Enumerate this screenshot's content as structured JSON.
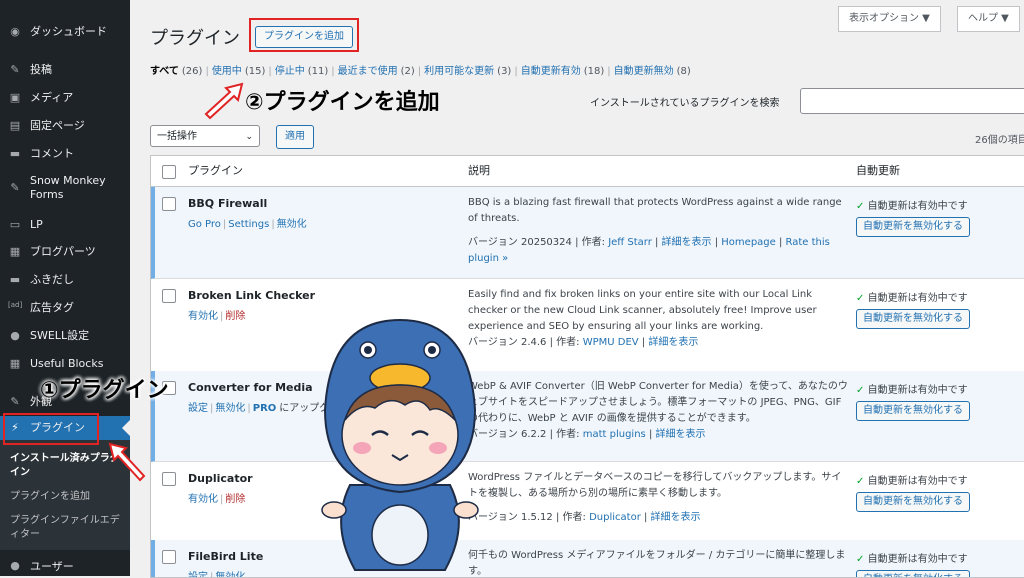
{
  "sidebar": {
    "items": [
      {
        "label": "ダッシュボード",
        "icon": "dashboard-icon",
        "glyph": "◉"
      },
      {
        "label": "投稿",
        "icon": "pin-icon",
        "glyph": "✎"
      },
      {
        "label": "メディア",
        "icon": "media-icon",
        "glyph": "▣"
      },
      {
        "label": "固定ページ",
        "icon": "page-icon",
        "glyph": "▤"
      },
      {
        "label": "コメント",
        "icon": "comment-icon",
        "glyph": "▬"
      },
      {
        "label": "Snow Monkey Forms",
        "icon": "pin-icon",
        "glyph": "✎"
      },
      {
        "label": "LP",
        "icon": "lp-icon",
        "glyph": "▭"
      },
      {
        "label": "ブログパーツ",
        "icon": "blog-parts-icon",
        "glyph": "▦"
      },
      {
        "label": "ふきだし",
        "icon": "balloon-icon",
        "glyph": "▬"
      },
      {
        "label": "広告タグ",
        "icon": "ad-icon",
        "glyph": "[ad]"
      },
      {
        "label": "SWELL設定",
        "icon": "swell-icon",
        "glyph": "●"
      },
      {
        "label": "Useful Blocks",
        "icon": "blocks-icon",
        "glyph": "▦"
      },
      {
        "label": "外観",
        "icon": "appearance-icon",
        "glyph": "✎"
      },
      {
        "label": "プラグイン",
        "icon": "plugin-icon",
        "glyph": "⚡"
      }
    ],
    "submenu": [
      "インストール済みプラグイン",
      "プラグインを追加",
      "プラグインファイルエディター"
    ],
    "user_label": "ユーザー"
  },
  "header": {
    "title": "プラグイン",
    "add_button": "プラグインを追加",
    "screen_options": "表示オプション ▼",
    "help": "ヘルプ ▼"
  },
  "filters": [
    {
      "label": "すべて",
      "count": "(26)"
    },
    {
      "label": "使用中",
      "count": "(15)"
    },
    {
      "label": "停止中",
      "count": "(11)"
    },
    {
      "label": "最近まで使用",
      "count": "(2)"
    },
    {
      "label": "利用可能な更新",
      "count": "(3)"
    },
    {
      "label": "自動更新有効",
      "count": "(18)"
    },
    {
      "label": "自動更新無効",
      "count": "(8)"
    }
  ],
  "search_label": "インストールされているプラグインを検索",
  "bulk_action": "一括操作",
  "apply_button": "適用",
  "item_count": "26個の項目",
  "table": {
    "headers": [
      "プラグイン",
      "説明",
      "自動更新"
    ],
    "rows": [
      {
        "name": "BBQ Firewall",
        "links": [
          "Go Pro",
          "Settings",
          "無効化"
        ],
        "desc": "BBQ is a blazing fast firewall that protects WordPress against a wide range of threats.",
        "version": "バージョン 20250324",
        "author_label": "作者:",
        "author": "Jeff Starr",
        "extra_links": [
          "詳細を表示",
          "Homepage",
          "Rate this plugin »"
        ],
        "au_status": "自動更新は有効中です",
        "au_button": "自動更新を無効化する"
      },
      {
        "name": "Broken Link Checker",
        "links": [
          "有効化",
          "削除"
        ],
        "desc": "Easily find and fix broken links on your entire site with our Local Link checker or the new Cloud Link scanner, absolutely free! Improve user experience and SEO by ensuring all your links are working.",
        "version": "バージョン 2.4.6",
        "author_label": "作者:",
        "author": "WPMU DEV",
        "extra_links": [
          "詳細を表示"
        ],
        "au_status": "自動更新は有効中です",
        "au_button": "自動更新を無効化する"
      },
      {
        "name": "Converter for Media",
        "links": [
          "設定",
          "無効化",
          "PRO",
          "にアップグレード"
        ],
        "desc": "WebP & AVIF Converter（旧 WebP Converter for Media）を使って、あなたのウェブサイトをスピードアップさせましょう。標準フォーマットの JPEG、PNG、GIF の代わりに、WebP と AVIF の画像を提供することができます。",
        "version": "バージョン 6.2.2",
        "author_label": "作者:",
        "author": "matt plugins",
        "extra_links": [
          "詳細を表示"
        ],
        "au_status": "自動更新は有効中です",
        "au_button": "自動更新を無効化する"
      },
      {
        "name": "Duplicator",
        "links": [
          "有効化",
          "削除"
        ],
        "desc": "WordPress ファイルとデータベースのコピーを移行してバックアップします。サイトを複製し、ある場所から別の場所に素早く移動します。",
        "version": "バージョン 1.5.12",
        "author_label": "作者:",
        "author": "Duplicator",
        "extra_links": [
          "詳細を表示"
        ],
        "au_status": "自動更新は有効中です",
        "au_button": "自動更新を無効化する"
      },
      {
        "name": "FileBird Lite",
        "links": [
          "設定",
          "無効化"
        ],
        "desc": "何千もの WordPress メディアファイルをフォルダー / カテゴリーに簡単に整理します。",
        "version": "",
        "author_label": "",
        "author": "",
        "extra_links": [],
        "au_status": "自動更新は有効中です",
        "au_button": "自動更新を無効化する"
      }
    ]
  },
  "annotations": {
    "step1": "①プラグイン",
    "step2": "②プラグインを追加"
  },
  "colors": {
    "sidebar_bg": "#1d2327",
    "accent": "#2271b1",
    "highlight_red": "#e02424",
    "delete_red": "#b32d2e",
    "check_green": "#00a32a"
  }
}
